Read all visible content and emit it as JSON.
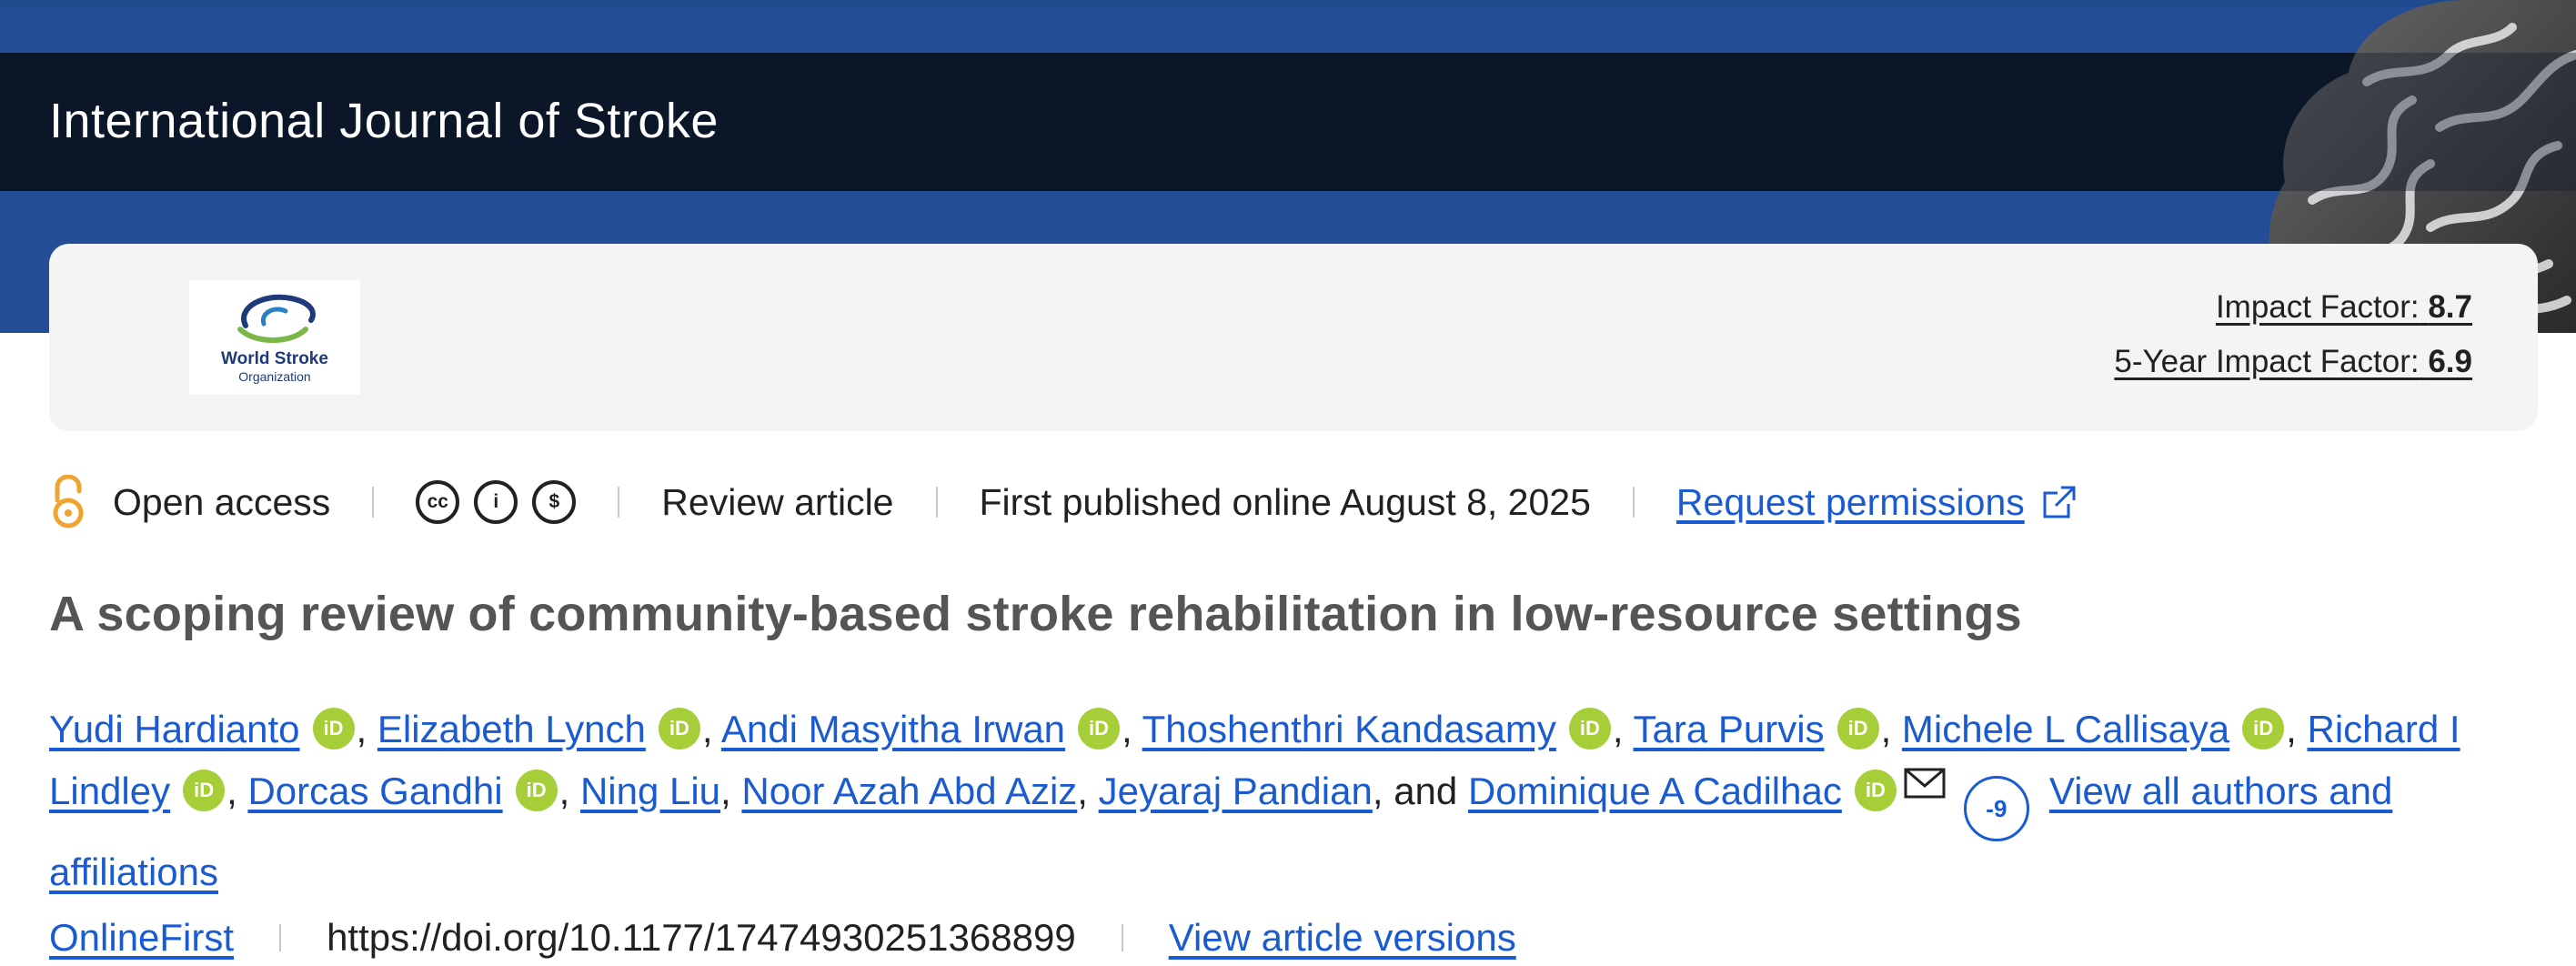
{
  "header": {
    "journal_title": "International Journal of Stroke"
  },
  "journal_info": {
    "logo": {
      "line1": "World Stroke",
      "line2": "Organization"
    },
    "impact_factor_label": "Impact Factor:",
    "impact_factor_value": "8.7",
    "five_year_label": "5-Year Impact Factor:",
    "five_year_value": "6.9"
  },
  "meta": {
    "access": "Open access",
    "license_icons": [
      "cc-icon",
      "by-icon",
      "nc-icon"
    ],
    "license_glyphs": [
      "cc",
      "i",
      "$"
    ],
    "article_type": "Review article",
    "published": "First published online August 8, 2025",
    "permissions_link": "Request permissions"
  },
  "article": {
    "title": "A scoping review of community-based stroke rehabilitation in low-resource settings"
  },
  "authors": {
    "list": [
      "Yudi Hardianto",
      "Elizabeth Lynch",
      "Andi Masyitha Irwan",
      "Thoshenthri Kandasamy",
      "Tara Purvis",
      "Michele L Callisaya",
      "Richard I Lindley",
      "Dorcas Gandhi",
      "Ning Liu",
      "Noor Azah Abd Aziz",
      "Jeyaraj Pandian",
      "Dominique A Cadilhac"
    ],
    "orcid_glyph": "iD",
    "conjunction": "and",
    "more_count": "-9",
    "view_all": "View all authors and affiliations"
  },
  "doi_row": {
    "section": "OnlineFirst",
    "doi": "https://doi.org/10.1177/17474930251368899",
    "versions": "View article versions"
  },
  "colors": {
    "header_blue": "#234e96",
    "title_bar": "#0b1629",
    "link": "#1a5bd1",
    "orcid_green": "#a6ce39",
    "open_access_orange": "#f0a330"
  }
}
